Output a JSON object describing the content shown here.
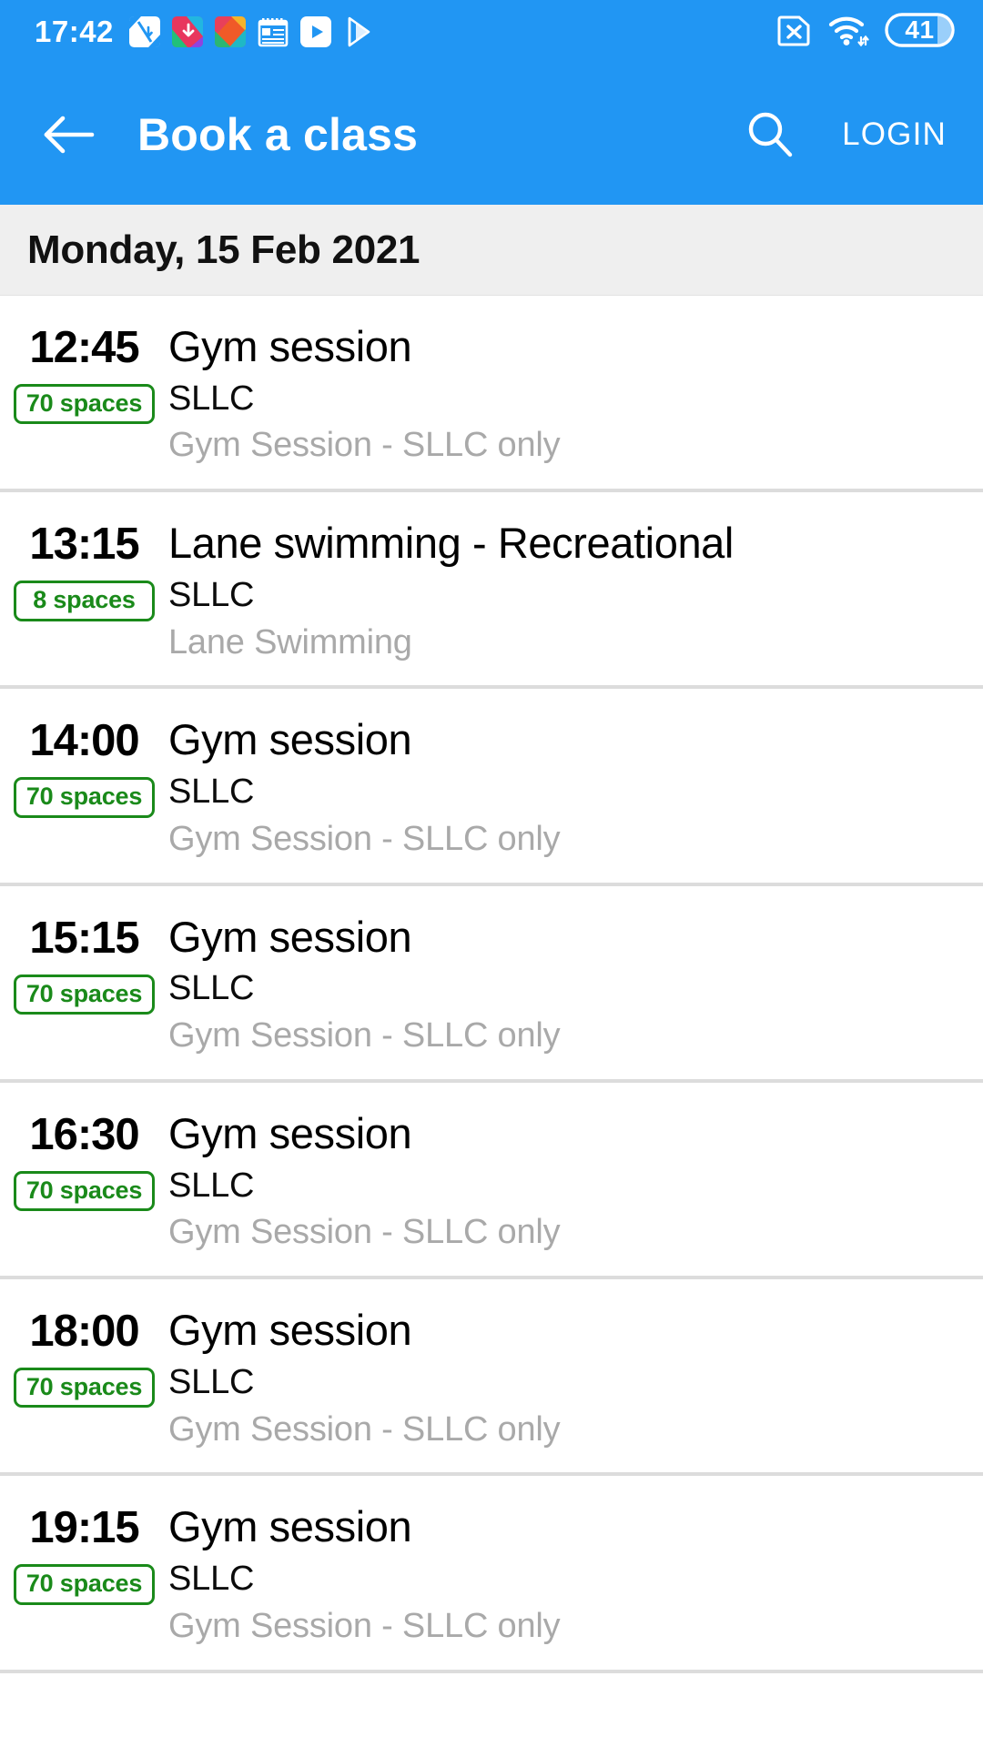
{
  "status_bar": {
    "time": "17:42",
    "left_icons": [
      {
        "name": "download-manager-icon",
        "label": "download"
      },
      {
        "name": "file-transfer-icon",
        "label": "transfer"
      },
      {
        "name": "gallery-icon",
        "label": "gallery"
      },
      {
        "name": "notes-icon",
        "label": "notes"
      },
      {
        "name": "youtube-icon",
        "label": "youtube"
      },
      {
        "name": "play-store-icon",
        "label": "play store"
      }
    ],
    "right_icons": [
      {
        "name": "no-sim-icon",
        "label": "no sim"
      },
      {
        "name": "wifi-icon",
        "label": "wifi"
      }
    ],
    "battery_level": "41"
  },
  "app_bar": {
    "back_label": "Back",
    "title": "Book a class",
    "search_label": "Search",
    "login_label": "LOGIN"
  },
  "date_header": {
    "label": "Monday, 15 Feb 2021"
  },
  "classes": [
    {
      "time": "12:45",
      "spaces": "70 spaces",
      "title": "Gym session",
      "venue": "SLLC",
      "description": "Gym Session - SLLC only"
    },
    {
      "time": "13:15",
      "spaces": "8 spaces",
      "title": "Lane swimming - Recreational",
      "venue": "SLLC",
      "description": "Lane Swimming"
    },
    {
      "time": "14:00",
      "spaces": "70 spaces",
      "title": "Gym session",
      "venue": "SLLC",
      "description": "Gym Session - SLLC only"
    },
    {
      "time": "15:15",
      "spaces": "70 spaces",
      "title": "Gym session",
      "venue": "SLLC",
      "description": "Gym Session - SLLC only"
    },
    {
      "time": "16:30",
      "spaces": "70 spaces",
      "title": "Gym session",
      "venue": "SLLC",
      "description": "Gym Session - SLLC only"
    },
    {
      "time": "18:00",
      "spaces": "70 spaces",
      "title": "Gym session",
      "venue": "SLLC",
      "description": "Gym Session - SLLC only"
    },
    {
      "time": "19:15",
      "spaces": "70 spaces",
      "title": "Gym session",
      "venue": "SLLC",
      "description": "Gym Session - SLLC only"
    }
  ],
  "colors": {
    "primary": "#2196f3",
    "badge_green": "#1a8a1a",
    "header_bg": "#efefef",
    "description_gray": "#a9a9a9",
    "divider": "#dcdcdc"
  }
}
